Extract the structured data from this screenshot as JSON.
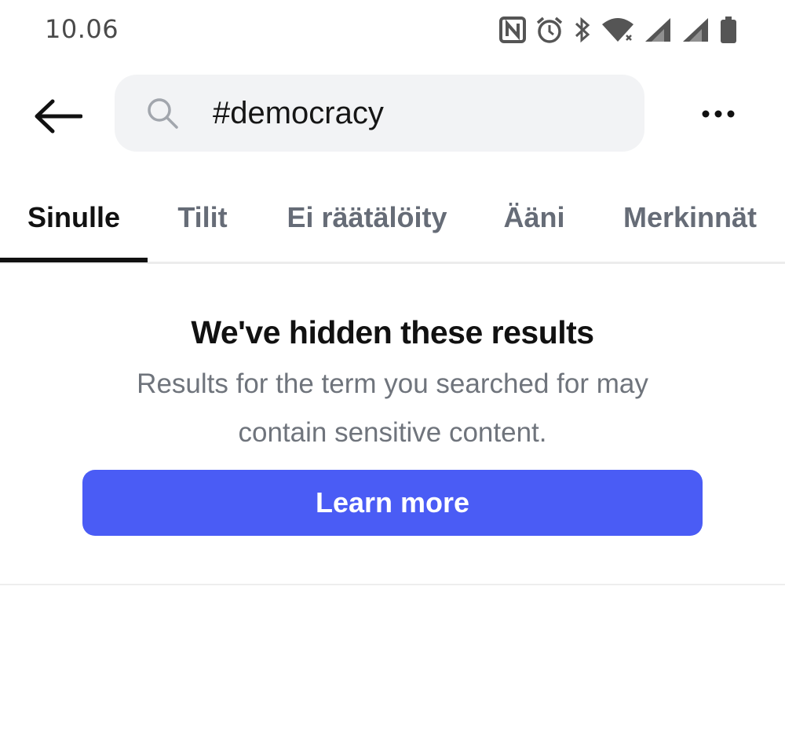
{
  "status_bar": {
    "time": "10.06",
    "icons": [
      "nfc-icon",
      "alarm-icon",
      "bluetooth-icon",
      "wifi-icon",
      "signal-icon",
      "signal-icon",
      "battery-icon"
    ]
  },
  "header": {
    "back_icon": "arrow-left-icon",
    "search_icon": "search-icon",
    "search_value": "#democracy",
    "more_icon": "more-horizontal-icon"
  },
  "tabs": [
    {
      "label": "Sinulle",
      "active": true
    },
    {
      "label": "Tilit",
      "active": false
    },
    {
      "label": "Ei räätälöity",
      "active": false
    },
    {
      "label": "Ääni",
      "active": false
    },
    {
      "label": "Merkinnät",
      "active": false
    }
  ],
  "notice": {
    "title": "We've hidden these results",
    "body": "Results for the term you searched for may contain sensitive content.",
    "button_label": "Learn more"
  },
  "colors": {
    "accent": "#4a5cf5",
    "search_bg": "#f2f3f5",
    "inactive_tab": "#666c77",
    "body_text": "#6f747c"
  }
}
